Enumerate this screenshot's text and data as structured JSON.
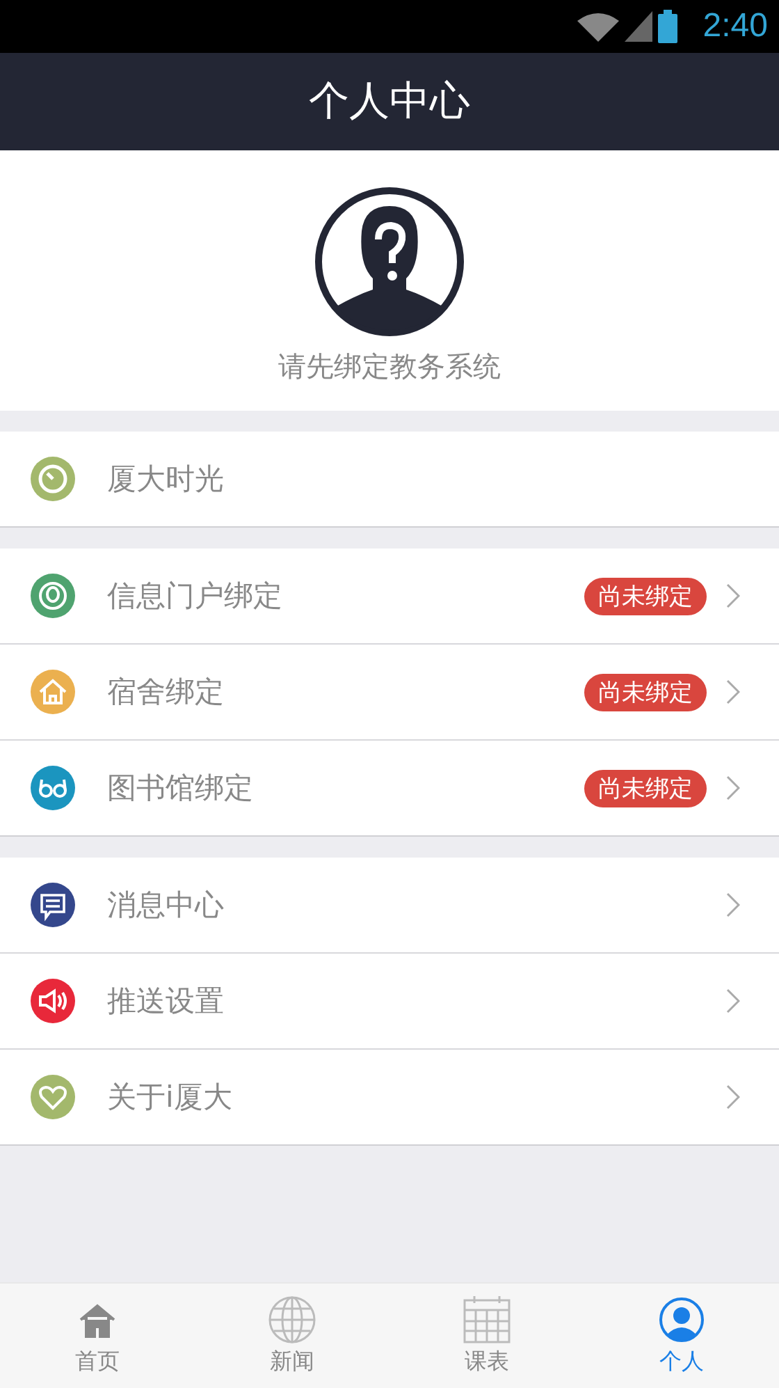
{
  "status_bar": {
    "time": "2:40"
  },
  "header": {
    "title": "个人中心"
  },
  "profile": {
    "prompt": "请先绑定教务系统"
  },
  "groups": [
    {
      "items": [
        {
          "label": "厦大时光",
          "color": "#a3b86c",
          "chevron": false
        }
      ]
    },
    {
      "items": [
        {
          "label": "信息门户绑定",
          "color": "#4fa36f",
          "badge": "尚未绑定",
          "chevron": true
        },
        {
          "label": "宿舍绑定",
          "color": "#ebb04f",
          "badge": "尚未绑定",
          "chevron": true
        },
        {
          "label": "图书馆绑定",
          "color": "#1b95bf",
          "badge": "尚未绑定",
          "chevron": true
        }
      ]
    },
    {
      "items": [
        {
          "label": "消息中心",
          "color": "#34478c",
          "chevron": true
        },
        {
          "label": "推送设置",
          "color": "#e8283a",
          "chevron": true
        },
        {
          "label": "关于i厦大",
          "color": "#a3b86c",
          "chevron": true
        }
      ]
    }
  ],
  "tabs": [
    {
      "label": "首页",
      "selected": false
    },
    {
      "label": "新闻",
      "selected": false
    },
    {
      "label": "课表",
      "selected": false
    },
    {
      "label": "个人",
      "selected": true
    }
  ]
}
